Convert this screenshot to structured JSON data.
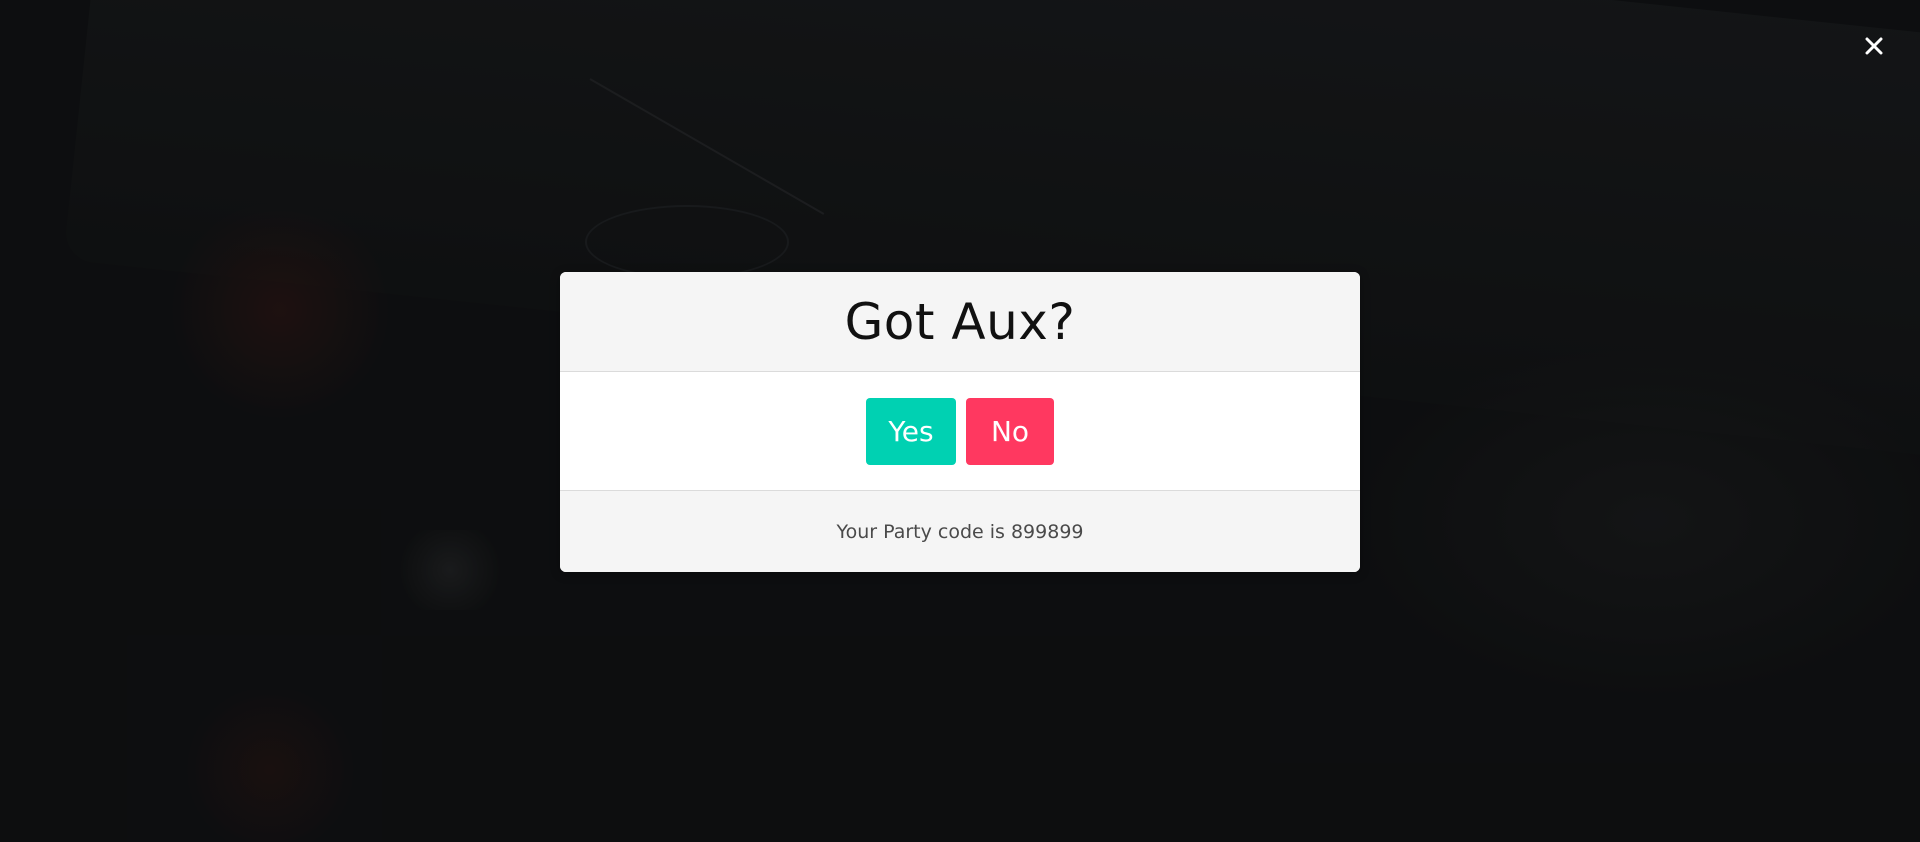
{
  "modal": {
    "title": "Got Aux?",
    "yes_label": "Yes",
    "no_label": "No",
    "party_code_text": "Your Party code is 899899"
  },
  "close_icon": "close-icon",
  "colors": {
    "yes_button": "#00d1b2",
    "no_button": "#ff3860",
    "header_footer_bg": "#f5f5f5",
    "backdrop": "#101214"
  }
}
